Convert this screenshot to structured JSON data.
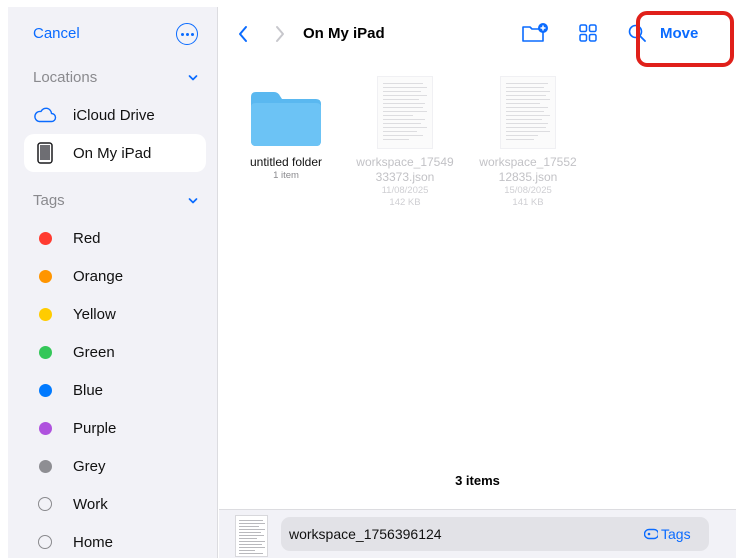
{
  "sidebar": {
    "cancel_label": "Cancel",
    "more_icon": "ellipsis-circle-icon",
    "locations_header": "Locations",
    "locations": [
      {
        "label": "iCloud Drive",
        "icon": "cloud-icon",
        "selected": false
      },
      {
        "label": "On My iPad",
        "icon": "ipad-icon",
        "selected": true
      }
    ],
    "tags_header": "Tags",
    "tags": [
      {
        "label": "Red",
        "color": "#ff3b30"
      },
      {
        "label": "Orange",
        "color": "#ff9500"
      },
      {
        "label": "Yellow",
        "color": "#ffcc00"
      },
      {
        "label": "Green",
        "color": "#34c759"
      },
      {
        "label": "Blue",
        "color": "#007aff"
      },
      {
        "label": "Purple",
        "color": "#af52de"
      },
      {
        "label": "Grey",
        "color": "#8e8e93"
      },
      {
        "label": "Work",
        "color": "none"
      },
      {
        "label": "Home",
        "color": "none"
      }
    ]
  },
  "toolbar": {
    "title": "On My iPad",
    "move_label": "Move",
    "icons": [
      "chevron-left-icon",
      "chevron-right-icon",
      "new-folder-icon",
      "grid-view-icon",
      "search-icon"
    ]
  },
  "files": [
    {
      "name": "untitled folder",
      "meta1": "1 item",
      "type": "folder",
      "enabled": true
    },
    {
      "name_line1": "workspace_17549",
      "name_line2": "33373.json",
      "date": "11/08/2025",
      "size": "142 KB",
      "type": "json",
      "enabled": false
    },
    {
      "name_line1": "workspace_17552",
      "name_line2": "12835.json",
      "date": "15/08/2025",
      "size": "141 KB",
      "type": "json",
      "enabled": false
    }
  ],
  "status": {
    "item_count": "3 items"
  },
  "save_bar": {
    "filename": "workspace_1756396124",
    "tags_label": "Tags"
  },
  "colors": {
    "accent": "#0a6bff",
    "highlight": "#e0201a",
    "folder": "#5ab8f0",
    "sidebar_bg": "#f2f2f7"
  }
}
